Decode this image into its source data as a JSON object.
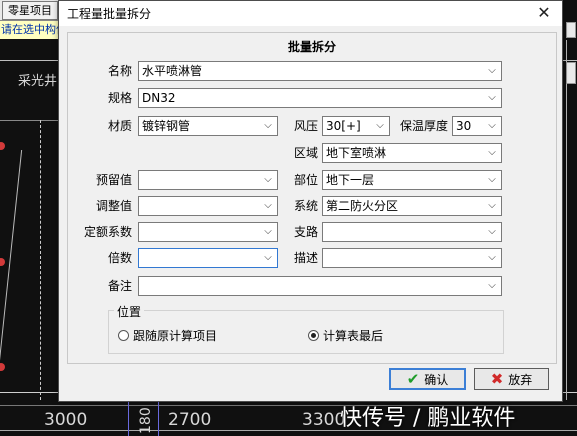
{
  "background": {
    "toolbar_button": "零星项目",
    "hint_text": "请在选中构件",
    "cad_label": "采光井",
    "dimensions": [
      "3000",
      "180",
      "2700",
      "3300"
    ]
  },
  "dialog": {
    "title": "工程量批量拆分",
    "panel_title": "批量拆分",
    "fields": {
      "name": {
        "label": "名称",
        "value": "水平喷淋管"
      },
      "spec": {
        "label": "规格",
        "value": "DN32"
      },
      "material": {
        "label": "材质",
        "value": "镀锌钢管"
      },
      "wind_pressure": {
        "label": "风压",
        "value": "30[+]"
      },
      "insulation": {
        "label": "保温厚度",
        "value": "30"
      },
      "region": {
        "label": "区域",
        "value": "地下室喷淋"
      },
      "reserved": {
        "label": "预留值",
        "value": ""
      },
      "location": {
        "label": "部位",
        "value": "地下一层"
      },
      "adjust": {
        "label": "调整值",
        "value": ""
      },
      "system": {
        "label": "系统",
        "value": "第二防火分区"
      },
      "quota_coef": {
        "label": "定额系数",
        "value": ""
      },
      "branch": {
        "label": "支路",
        "value": ""
      },
      "multiple": {
        "label": "倍数",
        "value": ""
      },
      "description": {
        "label": "描述",
        "value": ""
      },
      "remark": {
        "label": "备注",
        "value": ""
      }
    },
    "position_group": {
      "title": "位置",
      "option_follow": "跟随原计算项目",
      "option_last": "计算表最后",
      "selected": "option_last"
    },
    "ok_label": "确认",
    "cancel_label": "放弃"
  },
  "watermark": "快传号 / 鹏业软件"
}
